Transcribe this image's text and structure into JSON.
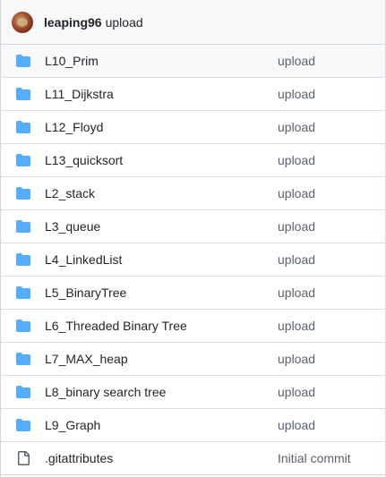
{
  "commit": {
    "author": "leaping96",
    "message": "upload"
  },
  "colors": {
    "folder": "#54aeff",
    "file": "#59636e",
    "header_bg": "#f6f8fa",
    "border": "#d0d7de"
  },
  "files": [
    {
      "name": "L10_Prim",
      "message": "upload",
      "type": "folder",
      "icon": "folder-icon"
    },
    {
      "name": "L11_Dijkstra",
      "message": "upload",
      "type": "folder",
      "icon": "folder-icon"
    },
    {
      "name": "L12_Floyd",
      "message": "upload",
      "type": "folder",
      "icon": "folder-icon"
    },
    {
      "name": "L13_quicksort",
      "message": "upload",
      "type": "folder",
      "icon": "folder-icon"
    },
    {
      "name": "L2_stack",
      "message": "upload",
      "type": "folder",
      "icon": "folder-icon"
    },
    {
      "name": "L3_queue",
      "message": "upload",
      "type": "folder",
      "icon": "folder-icon"
    },
    {
      "name": "L4_LinkedList",
      "message": "upload",
      "type": "folder",
      "icon": "folder-icon"
    },
    {
      "name": "L5_BinaryTree",
      "message": "upload",
      "type": "folder",
      "icon": "folder-icon"
    },
    {
      "name": "L6_Threaded Binary Tree",
      "message": "upload",
      "type": "folder",
      "icon": "folder-icon"
    },
    {
      "name": "L7_MAX_heap",
      "message": "upload",
      "type": "folder",
      "icon": "folder-icon"
    },
    {
      "name": "L8_binary search tree",
      "message": "upload",
      "type": "folder",
      "icon": "folder-icon"
    },
    {
      "name": "L9_Graph",
      "message": "upload",
      "type": "folder",
      "icon": "folder-icon"
    },
    {
      "name": ".gitattributes",
      "message": "Initial commit",
      "type": "file",
      "icon": "file-icon"
    }
  ]
}
